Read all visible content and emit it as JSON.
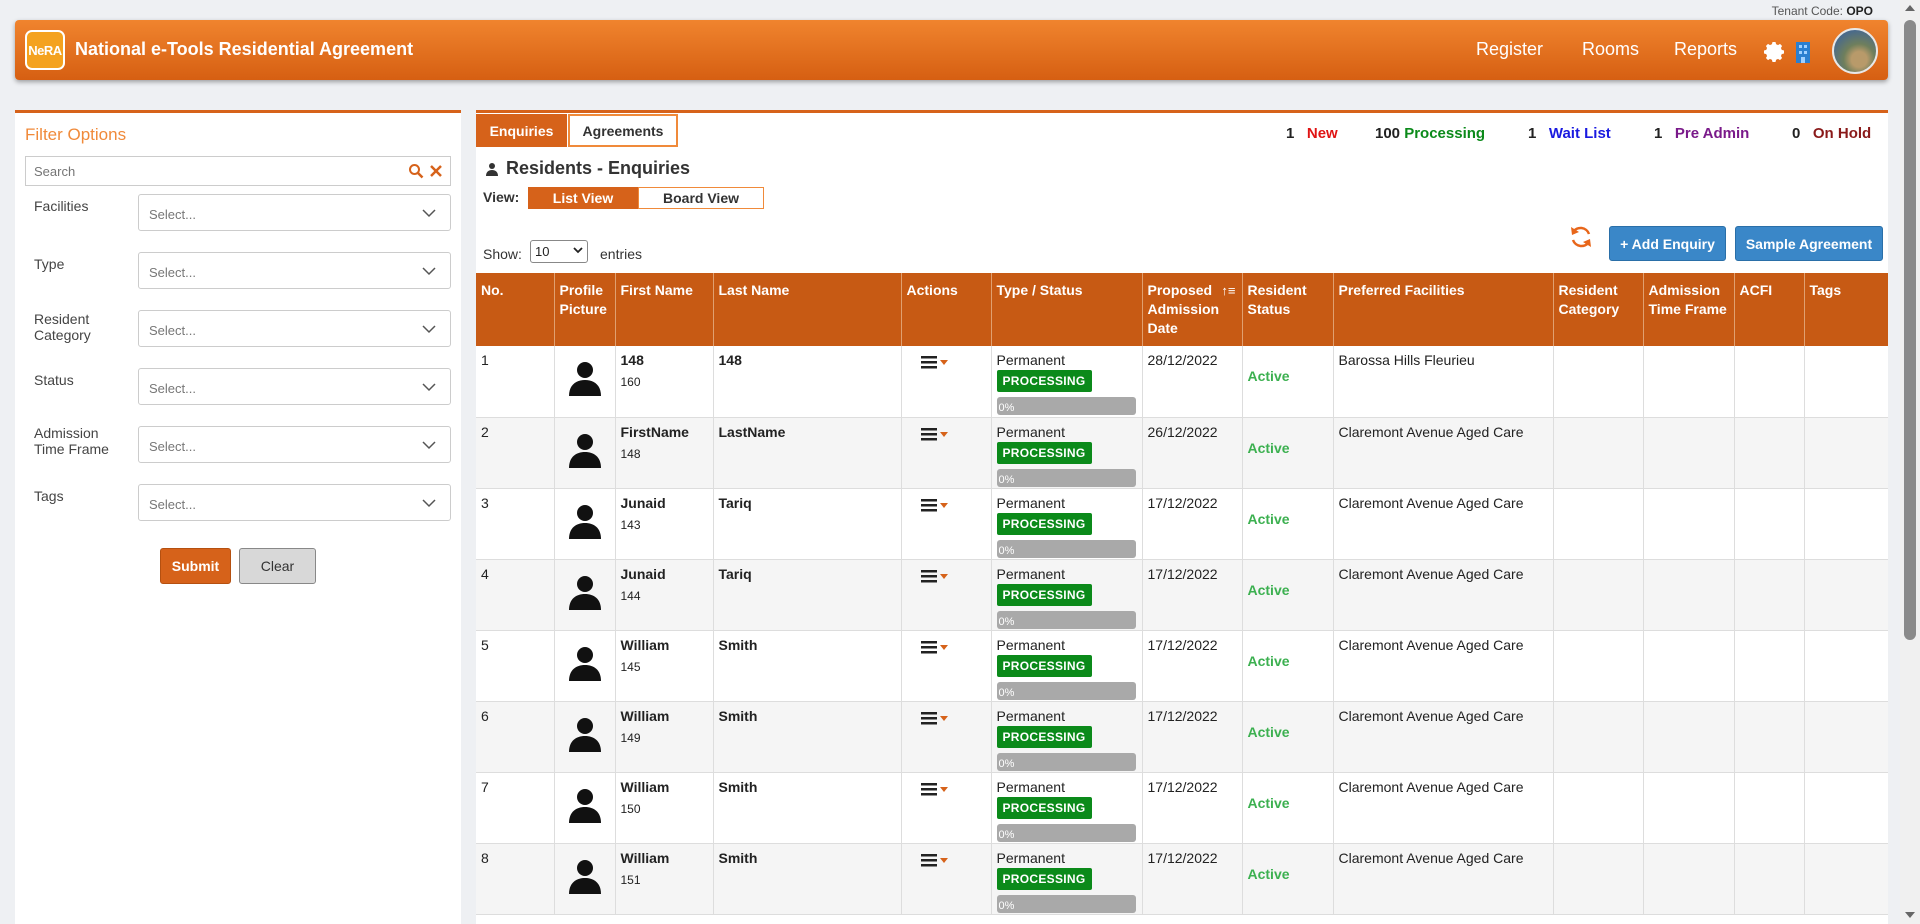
{
  "tenant": {
    "label": "Tenant Code:",
    "code": "OPO"
  },
  "header": {
    "logo": "NeRA",
    "title": "National e-Tools Residential Agreement",
    "nav": [
      "Register",
      "Rooms",
      "Reports"
    ]
  },
  "filter": {
    "title": "Filter Options",
    "search_placeholder": "Search",
    "fields": [
      {
        "label": "Facilities",
        "value": "Select..."
      },
      {
        "label": "Type",
        "value": "Select..."
      },
      {
        "label": "Resident Category",
        "value": "Select..."
      },
      {
        "label": "Status",
        "value": "Select..."
      },
      {
        "label": "Admission Time Frame",
        "value": "Select..."
      },
      {
        "label": "Tags",
        "value": "Select..."
      }
    ],
    "submit": "Submit",
    "clear": "Clear"
  },
  "tabs": [
    "Enquiries",
    "Agreements"
  ],
  "stats": [
    {
      "count": "1",
      "label": "New",
      "color": "#e01414"
    },
    {
      "count": "100",
      "label": "Processing",
      "color": "#0b8a1a"
    },
    {
      "count": "1",
      "label": "Wait List",
      "color": "#1a1ae0"
    },
    {
      "count": "1",
      "label": "Pre Admin",
      "color": "#7a1a8a"
    },
    {
      "count": "0",
      "label": "On Hold",
      "color": "#8a1a1a"
    }
  ],
  "page_title": "Residents - Enquiries",
  "view": {
    "label": "View:",
    "list": "List View",
    "board": "Board View"
  },
  "show": {
    "label": "Show:",
    "value": "10",
    "suffix": "entries"
  },
  "buttons": {
    "add": "+ Add Enquiry",
    "sample": "Sample Agreement"
  },
  "columns": [
    "No.",
    "Profile Picture",
    "First Name",
    "Last Name",
    "Actions",
    "Type / Status",
    "Proposed Admission Date",
    "Resident Status",
    "Preferred Facilities",
    "Resident Category",
    "Admission Time Frame",
    "ACFI",
    "Tags"
  ],
  "rows": [
    {
      "no": "1",
      "first": "148",
      "id": "160",
      "last": "148",
      "type": "Permanent",
      "status": "PROCESSING",
      "progress": "0%",
      "date": "28/12/2022",
      "rstatus": "Active",
      "facility": "Barossa Hills Fleurieu"
    },
    {
      "no": "2",
      "first": "FirstName",
      "id": "148",
      "last": "LastName",
      "type": "Permanent",
      "status": "PROCESSING",
      "progress": "0%",
      "date": "26/12/2022",
      "rstatus": "Active",
      "facility": "Claremont Avenue Aged Care"
    },
    {
      "no": "3",
      "first": "Junaid",
      "id": "143",
      "last": "Tariq",
      "type": "Permanent",
      "status": "PROCESSING",
      "progress": "0%",
      "date": "17/12/2022",
      "rstatus": "Active",
      "facility": "Claremont Avenue Aged Care"
    },
    {
      "no": "4",
      "first": "Junaid",
      "id": "144",
      "last": "Tariq",
      "type": "Permanent",
      "status": "PROCESSING",
      "progress": "0%",
      "date": "17/12/2022",
      "rstatus": "Active",
      "facility": "Claremont Avenue Aged Care"
    },
    {
      "no": "5",
      "first": "William",
      "id": "145",
      "last": "Smith",
      "type": "Permanent",
      "status": "PROCESSING",
      "progress": "0%",
      "date": "17/12/2022",
      "rstatus": "Active",
      "facility": "Claremont Avenue Aged Care"
    },
    {
      "no": "6",
      "first": "William",
      "id": "149",
      "last": "Smith",
      "type": "Permanent",
      "status": "PROCESSING",
      "progress": "0%",
      "date": "17/12/2022",
      "rstatus": "Active",
      "facility": "Claremont Avenue Aged Care"
    },
    {
      "no": "7",
      "first": "William",
      "id": "150",
      "last": "Smith",
      "type": "Permanent",
      "status": "PROCESSING",
      "progress": "0%",
      "date": "17/12/2022",
      "rstatus": "Active",
      "facility": "Claremont Avenue Aged Care"
    },
    {
      "no": "8",
      "first": "William",
      "id": "151",
      "last": "Smith",
      "type": "Permanent",
      "status": "PROCESSING",
      "progress": "0%",
      "date": "17/12/2022",
      "rstatus": "Active",
      "facility": "Claremont Avenue Aged Care"
    }
  ]
}
